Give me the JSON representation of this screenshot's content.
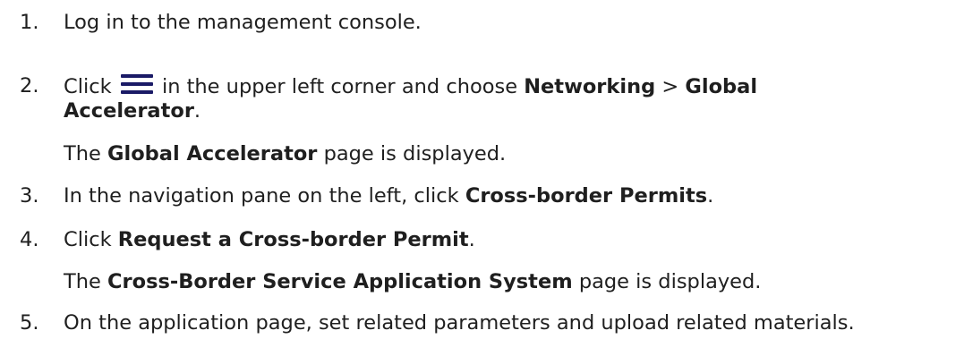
{
  "steps": [
    {
      "number": "1.",
      "text": "Log in to the management console."
    },
    {
      "number": "2.",
      "text_before_icon": "Click",
      "icon": "hamburger-menu-icon",
      "text_after_icon": "in the upper left corner and choose",
      "bold1": "Networking",
      "sep": ">",
      "bold2_line1": "Global",
      "bold2_line2": "Accelerator",
      "end": ".",
      "note_bold": "Global Accelerator",
      "note_rest": "page is displayed."
    },
    {
      "number": "3.",
      "text": "In the navigation pane on the left, click",
      "bold": "Cross-border Permits",
      "end": "."
    },
    {
      "number": "4.",
      "text": "Click",
      "bold": "Request a Cross-border Permit",
      "end": ".",
      "note_pre": "The",
      "note_bold": "Cross-Border Service Application System",
      "note_rest": "page is displayed."
    },
    {
      "number": "5.",
      "text": "On the application page, set related parameters and upload related materials."
    }
  ]
}
